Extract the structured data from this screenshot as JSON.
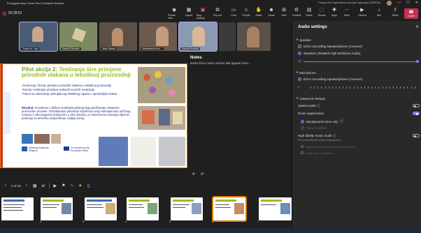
{
  "titlebar": {
    "title": "Energyjeb  skup Green Tec & Dinamic Danube",
    "search": "Farsporine regionalne razvojne agencije (GREDA)",
    "controls": [
      "—",
      "☐",
      "✕"
    ]
  },
  "toolbar": {
    "timer": "02:28:51",
    "buttons": [
      {
        "label": "Private view",
        "icon": "eye-icon"
      },
      {
        "label": "Layout",
        "icon": "layout-icon"
      },
      {
        "label": "Stop sharing",
        "icon": "stop-share-icon"
      },
      {
        "label": "Pop out",
        "icon": "popout-icon"
      },
      {
        "label": "Chat",
        "icon": "chat-icon"
      },
      {
        "label": "People",
        "icon": "people-icon"
      },
      {
        "label": "Raise",
        "icon": "hand-icon"
      },
      {
        "label": "React",
        "icon": "smile-icon"
      },
      {
        "label": "View",
        "icon": "view-icon"
      },
      {
        "label": "Controls",
        "icon": "controls-icon"
      },
      {
        "label": "Notes",
        "icon": "notes-icon"
      },
      {
        "label": "Rooms",
        "icon": "rooms-icon"
      },
      {
        "label": "Apps",
        "icon": "apps-icon"
      },
      {
        "label": "More",
        "icon": "more-icon"
      },
      {
        "label": "Camera",
        "icon": "camera-icon"
      },
      {
        "label": "Mic",
        "icon": "mic-icon"
      },
      {
        "label": "Share",
        "icon": "share-icon"
      }
    ],
    "leave": "Leave"
  },
  "participants": [
    {
      "name": "Goran M. Vojo",
      "color": "#4a5c74"
    },
    {
      "name": "Sanela Zibodan",
      "color": "#7c8a64"
    },
    {
      "name": "Alda Zbikica",
      "color": "#5b5048"
    },
    {
      "name": "Klementina Kerz...",
      "color": "#6c5a4e"
    },
    {
      "name": "Sandra Brezhof",
      "color": "#8a9ab0"
    },
    {
      "name": "",
      "color": "#3b3b3b"
    },
    {
      "name": "",
      "color": "#595048"
    }
  ],
  "slide": {
    "title_prefix": "Pilot akcija 2:",
    "title_rest": "Testiranje šire primjene prirodnih vlakana u tekstilnoj proizvodnji",
    "bullets": [
      "-Promocija i širenje primjene prirodnih vlakana u tekstilnoj proizvodnji",
      "-Razvoj i testiranje prototipa netkanih vunenih materijala",
      "-Fokus na valorizaciju prikupljenog tekstilnog otpada u upotrebljiva vlakna."
    ],
    "result_title": "Rezultat:",
    "result_text": "Inovativna i održiva materijala rješenja koja podržavaju cirkularne proizvodne procese. Prototipiranje potvrđuje vrijednost ovog materijala kao održivog resursa s obećavajućim primjenom u više sektora, uz istovremeno isticanje ključnih područja za tehničko unapređenje i daljnji razvoj.",
    "programme": "Interreg Danube Region",
    "eu_text": "Co-funded by the European Union"
  },
  "notes": {
    "heading": "Notes",
    "placeholder": "Notes from notes section will appear here..."
  },
  "zoom": {
    "out": "A⁻",
    "in": "A⁺"
  },
  "slidectl": {
    "page": "6 of 15"
  },
  "thumbnails": [
    {
      "num": "2"
    },
    {
      "num": "3"
    },
    {
      "num": "4"
    },
    {
      "num": "5"
    },
    {
      "num": "6"
    },
    {
      "num": "7"
    }
  ],
  "audio": {
    "title": "Audio settings",
    "speaker_section": "Speaker",
    "speakers": [
      {
        "label": "Echo Cancelling Speakerphone (Connect)",
        "selected": false
      },
      {
        "label": "Speakers (Realtek High Definition Audio)",
        "selected": true
      }
    ],
    "speaker_volume": 0.97,
    "mic_section": "Microphone",
    "mics": [
      {
        "label": "Echo Cancelling Speakerphone (Connect)",
        "selected": true
      }
    ],
    "mic_level": 0.0,
    "advanced_section": "Advanced settings",
    "spatial_audio": "Spatial audio",
    "noise_suppression": "Noise suppression",
    "noise_options": [
      {
        "label": "Background noise only",
        "selected": true
      },
      {
        "label": "Voice isolation",
        "selected": false
      }
    ],
    "hifi_mode": "High fidelity music mode",
    "hifi_sub": "Recommended for studio environments",
    "hifi_options": [
      "Original sound for microphone computer audio",
      "Enable stereo conditioner"
    ]
  },
  "colors": {
    "accent": "#8b7cf6",
    "leave": "#c4314b",
    "selection": "#e07b00",
    "green_title": "#9bbb1c"
  }
}
